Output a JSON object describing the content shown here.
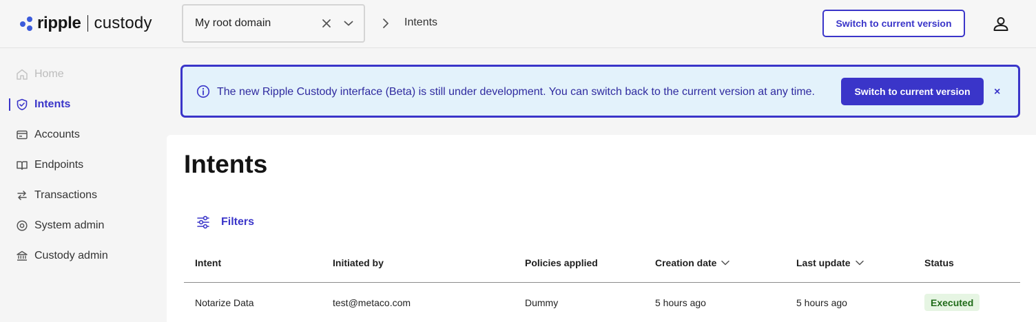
{
  "header": {
    "logo_word": "ripple",
    "logo_product": "custody",
    "domain_select": {
      "value": "My root domain"
    },
    "breadcrumb": "Intents",
    "switch_button": "Switch to current version"
  },
  "sidebar": {
    "items": [
      {
        "label": "Home",
        "icon": "home-icon",
        "state": "disabled"
      },
      {
        "label": "Intents",
        "icon": "shield-check-icon",
        "state": "active"
      },
      {
        "label": "Accounts",
        "icon": "wallet-icon",
        "state": "normal"
      },
      {
        "label": "Endpoints",
        "icon": "book-icon",
        "state": "normal"
      },
      {
        "label": "Transactions",
        "icon": "transfer-icon",
        "state": "normal"
      },
      {
        "label": "System admin",
        "icon": "gear-icon",
        "state": "normal"
      },
      {
        "label": "Custody admin",
        "icon": "bank-icon",
        "state": "normal"
      }
    ]
  },
  "banner": {
    "message": "The new Ripple Custody interface (Beta) is still under development. You can switch back to the current version at any time.",
    "button": "Switch to current version",
    "close": "×"
  },
  "main": {
    "title": "Intents",
    "filters_label": "Filters",
    "table": {
      "columns": [
        "Intent",
        "Initiated by",
        "Policies applied",
        "Creation date",
        "Last update",
        "Status"
      ],
      "rows": [
        {
          "intent": "Notarize Data",
          "initiated_by": "test@metaco.com",
          "policies": "Dummy",
          "created": "5 hours ago",
          "updated": "5 hours ago",
          "status": "Executed"
        }
      ]
    }
  },
  "colors": {
    "accent": "#3a35c9",
    "banner_bg": "#e3f2fb",
    "status_success_bg": "#e6f5e3",
    "status_success_text": "#1f6b18"
  }
}
